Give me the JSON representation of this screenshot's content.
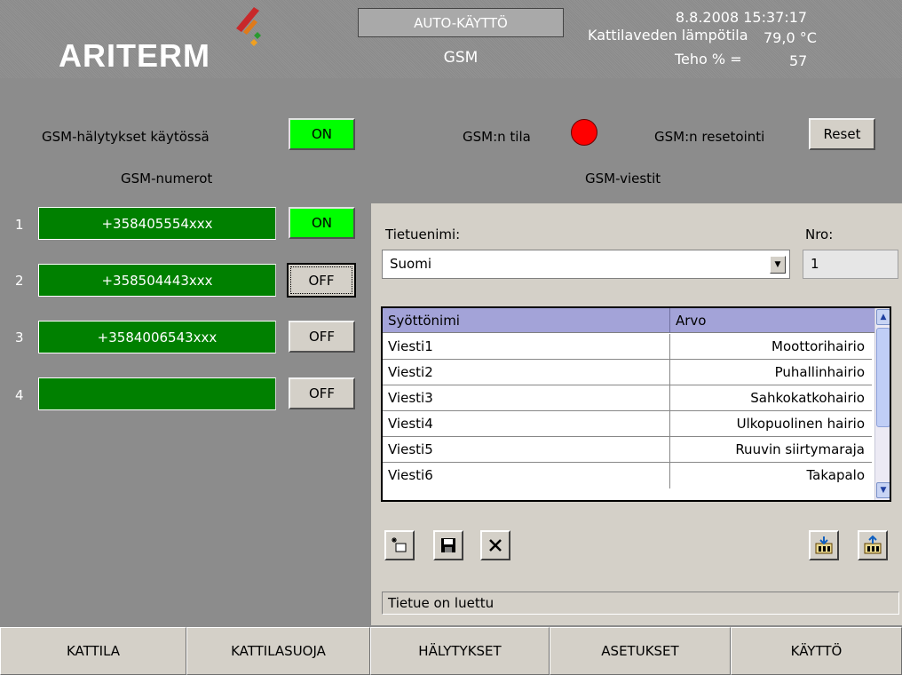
{
  "header": {
    "logo_text": "ARITERM",
    "mode": "AUTO-KÄYTTÖ",
    "screen": "GSM",
    "datetime": "8.8.2008 15:37:17",
    "temp_label": "Kattilaveden lämpötila",
    "temp_value": "79,0  °C",
    "power_label": "Teho % =",
    "power_value": "57"
  },
  "gsm": {
    "alarms_label": "GSM-hälytykset käytössä",
    "alarms_state": "ON",
    "state_label": "GSM:n tila",
    "state_indicator_color": "#ff0000",
    "reset_label": "GSM:n resetointi",
    "reset_button": "Reset",
    "numbers_title": "GSM-numerot",
    "messages_title": "GSM-viestit",
    "numbers": [
      {
        "index": "1",
        "number": "+358405554xxx",
        "state": "ON"
      },
      {
        "index": "2",
        "number": "+358504443xxx",
        "state": "OFF"
      },
      {
        "index": "3",
        "number": "+3584006543xxx",
        "state": "OFF"
      },
      {
        "index": "4",
        "number": "",
        "state": "OFF"
      }
    ]
  },
  "record": {
    "name_label": "Tietuenimi:",
    "name_value": "Suomi",
    "nro_label": "Nro:",
    "nro_value": "1"
  },
  "grid": {
    "columns": [
      "Syöttönimi",
      "Arvo"
    ],
    "rows": [
      {
        "name": "Viesti1",
        "value": "Moottorihairio"
      },
      {
        "name": "Viesti2",
        "value": "Puhallinhairio"
      },
      {
        "name": "Viesti3",
        "value": "Sahkokatkohairio"
      },
      {
        "name": "Viesti4",
        "value": "Ulkopuolinen hairio"
      },
      {
        "name": "Viesti5",
        "value": "Ruuvin siirtymaraja"
      },
      {
        "name": "Viesti6",
        "value": "Takapalo"
      }
    ]
  },
  "toolbar": {
    "icons": [
      "new-record-icon",
      "save-icon",
      "delete-icon",
      "import-icon",
      "export-icon"
    ]
  },
  "status": "Tietue on luettu",
  "nav": [
    "KATTILA",
    "KATTILASUOJA",
    "HÄLYTYKSET",
    "ASETUKSET",
    "KÄYTTÖ"
  ],
  "colors": {
    "on_green": "#00ff00",
    "number_green": "#008000",
    "grid_header": "#a3a3d8",
    "panel_gray": "#8c8c8c"
  }
}
